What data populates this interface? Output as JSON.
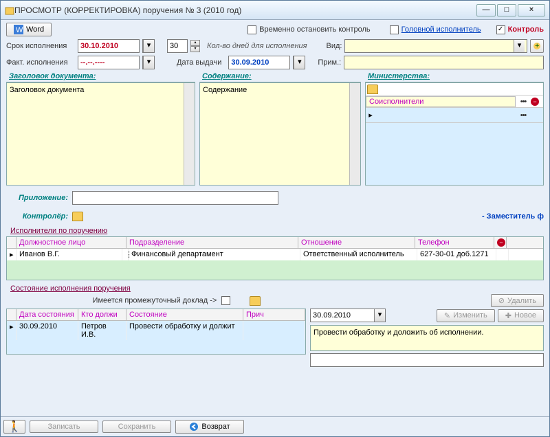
{
  "title": "ПРОСМОТР (КОРРЕКТИРОВКА) поручения № 3 (2010 год)",
  "toolbar": {
    "word": "Word",
    "pause_control": "Временно остановить контроль",
    "head_executor": "Головной исполнитель",
    "control": "Контроль"
  },
  "dates": {
    "due_label": "Срок исполнения",
    "due_value": "30.10.2010",
    "days": "30",
    "days_hint": "Кол-во дней для исполнения",
    "kind_label": "Вид:",
    "fact_label": "Факт. исполнения",
    "fact_value": "--.--.----",
    "issue_label": "Дата выдачи",
    "issue_value": "30.09.2010",
    "note_label": "Прим.:"
  },
  "panels": {
    "doc_title_h": "Заголовок документа:",
    "doc_title_text": "Заголовок документа",
    "content_h": "Содержание:",
    "content_text": "Содержание",
    "ministries_h": "Министерства:",
    "coexecutors": "Соисполнители"
  },
  "attach": {
    "label": "Приложение:",
    "controller": "Контролёр:",
    "controller_value": "- Заместитель ф"
  },
  "executors": {
    "section": "Исполнители по поручению",
    "cols": [
      "Должностное лицо",
      "Подразделение",
      "Отношение",
      "Телефон"
    ],
    "row": [
      "Иванов В.Г.",
      "Финансовый департамент",
      "Ответственный исполнитель",
      "627-30-01 доб.1271"
    ]
  },
  "status": {
    "section": "Состояние исполнения поручения",
    "interim": "Имеется промежуточный доклад ->",
    "delete": "Удалить",
    "edit": "Изменить",
    "new": "Новое",
    "cols": [
      "Дата состояния",
      "Кто должи",
      "Состояние",
      "Прич"
    ],
    "row": [
      "30.09.2010",
      "Петров И.В.",
      "Провести обработку и должит",
      ""
    ],
    "date2": "30.09.2010",
    "note": "Провести обработку и доложить об исполнении."
  },
  "footer": {
    "save": "Записать",
    "store": "Сохранить",
    "return": "Возврат"
  }
}
